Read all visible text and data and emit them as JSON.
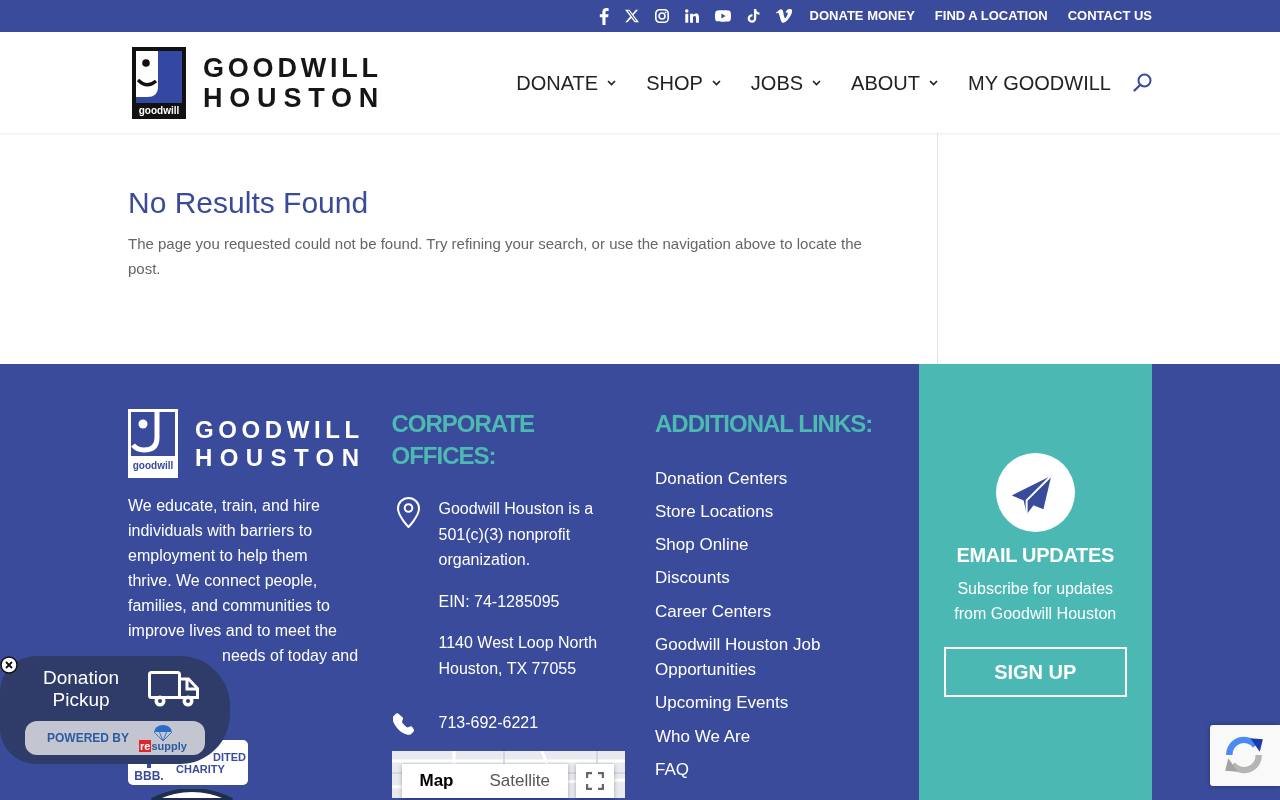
{
  "top_bar": {
    "social": [
      {
        "kind": "facebook"
      },
      {
        "kind": "x"
      },
      {
        "kind": "instagram"
      },
      {
        "kind": "linkedin"
      },
      {
        "kind": "youtube"
      },
      {
        "kind": "tiktok"
      },
      {
        "kind": "vimeo"
      }
    ],
    "links": [
      "DONATE MONEY",
      "FIND A LOCATION",
      "CONTACT US"
    ]
  },
  "header": {
    "logo": {
      "mark_text": "goodwill",
      "lines": [
        "GOODWILL",
        "HOUSTON"
      ]
    },
    "nav": [
      {
        "label": "DONATE",
        "submenu": true
      },
      {
        "label": "SHOP",
        "submenu": true
      },
      {
        "label": "JOBS",
        "submenu": true
      },
      {
        "label": "ABOUT",
        "submenu": true
      },
      {
        "label": "MY GOODWILL",
        "submenu": false
      }
    ]
  },
  "content": {
    "title": "No Results Found",
    "message": "The page you requested could not be found. Try refining your search, or use the navigation above to locate the post."
  },
  "footer": {
    "about": {
      "logo": {
        "mark_text": "goodwill",
        "lines": [
          "GOODWILL",
          "HOUSTON"
        ]
      },
      "mission_lines": [
        "We educate, train, and hire",
        "individuals with barriers to",
        "employment to help them",
        "thrive. We connect people,",
        "families, and communities to",
        "improve lives and to meet the",
        "needs of today and"
      ],
      "badge": {
        "logo_text": "BBB.",
        "lines": [
          "DITED",
          "CHARITY"
        ]
      }
    },
    "offices": {
      "heading": "CORPORATE OFFICES:",
      "items": [
        {
          "kind": "location",
          "paragraphs": [
            [
              "Goodwill Houston is a 501(c)(3) nonprofit organization."
            ],
            [
              "EIN: 74-1285095"
            ],
            [
              "1140 West Loop North",
              "Houston, TX 77055"
            ]
          ]
        },
        {
          "kind": "phone",
          "paragraphs": [
            [
              "713-692-6221"
            ]
          ]
        }
      ],
      "map": {
        "views": [
          {
            "label": "Map",
            "selected": true
          },
          {
            "label": "Satellite",
            "selected": false
          }
        ]
      }
    },
    "links": {
      "heading": "ADDITIONAL LINKS:",
      "items": [
        "Donation Centers",
        "Store Locations",
        "Shop Online",
        "Discounts",
        "Career Centers",
        "Goodwill Houston Job Opportunities",
        "Upcoming Events",
        "Who We Are",
        "FAQ"
      ]
    },
    "newsletter": {
      "heading": "EMAIL UPDATES",
      "text": "Subscribe for updates from Goodwill Houston",
      "button": "SIGN UP"
    }
  },
  "pickup_widget": {
    "title": "Donation Pickup",
    "powered_by": "POWERED BY",
    "brand": {
      "prefix": "re",
      "rest": "supply"
    }
  }
}
